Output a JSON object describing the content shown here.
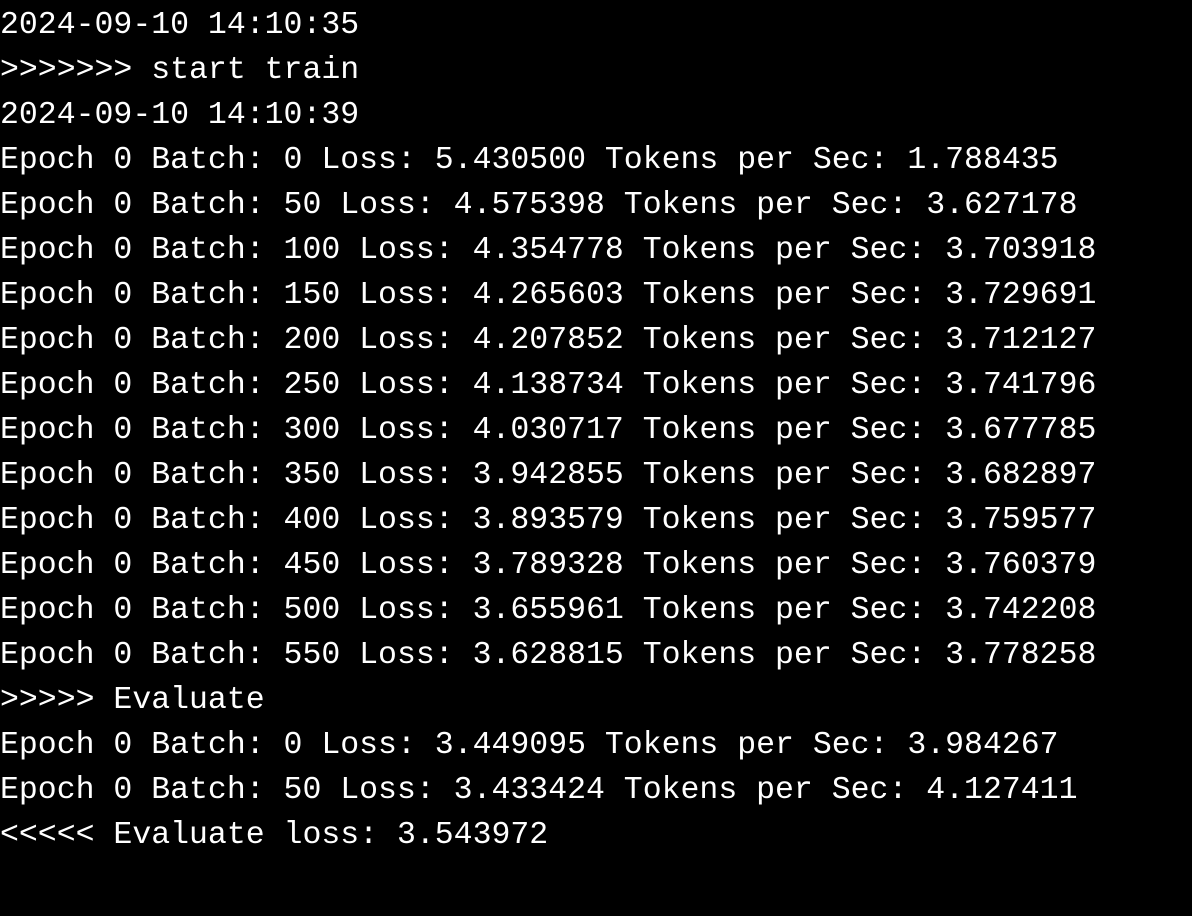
{
  "terminal": {
    "background": "#000000",
    "foreground": "#ffffff",
    "lines": [
      "2024-09-10 14:10:35",
      ">>>>>>> start train",
      "2024-09-10 14:10:39",
      "Epoch 0 Batch: 0 Loss: 5.430500 Tokens per Sec: 1.788435",
      "Epoch 0 Batch: 50 Loss: 4.575398 Tokens per Sec: 3.627178",
      "Epoch 0 Batch: 100 Loss: 4.354778 Tokens per Sec: 3.703918",
      "Epoch 0 Batch: 150 Loss: 4.265603 Tokens per Sec: 3.729691",
      "Epoch 0 Batch: 200 Loss: 4.207852 Tokens per Sec: 3.712127",
      "Epoch 0 Batch: 250 Loss: 4.138734 Tokens per Sec: 3.741796",
      "Epoch 0 Batch: 300 Loss: 4.030717 Tokens per Sec: 3.677785",
      "Epoch 0 Batch: 350 Loss: 3.942855 Tokens per Sec: 3.682897",
      "Epoch 0 Batch: 400 Loss: 3.893579 Tokens per Sec: 3.759577",
      "Epoch 0 Batch: 450 Loss: 3.789328 Tokens per Sec: 3.760379",
      "Epoch 0 Batch: 500 Loss: 3.655961 Tokens per Sec: 3.742208",
      "Epoch 0 Batch: 550 Loss: 3.628815 Tokens per Sec: 3.778258",
      ">>>>> Evaluate",
      "Epoch 0 Batch: 0 Loss: 3.449095 Tokens per Sec: 3.984267",
      "Epoch 0 Batch: 50 Loss: 3.433424 Tokens per Sec: 4.127411",
      "<<<<< Evaluate loss: 3.543972"
    ]
  }
}
